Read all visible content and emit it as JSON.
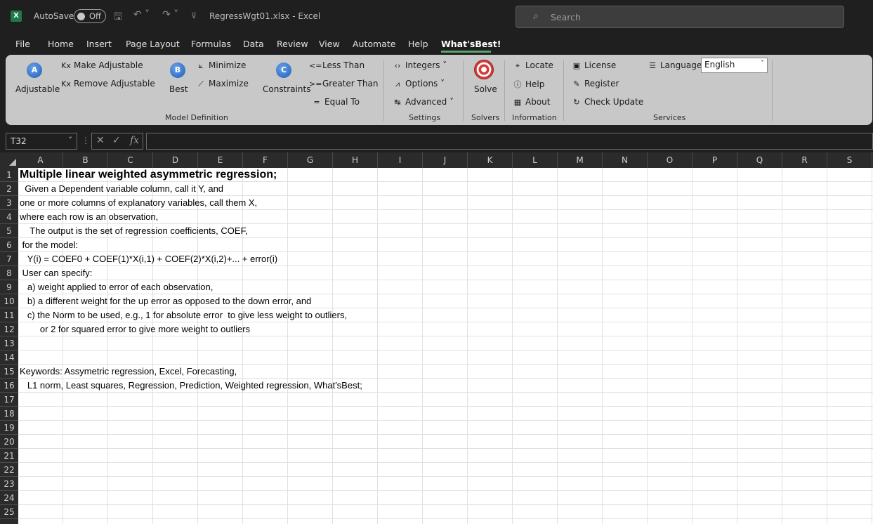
{
  "titlebar": {
    "app_icon": "X",
    "autosave_label": "AutoSave",
    "autosave_state": "Off",
    "document_title": "RegressWgt01.xlsx  -  Excel",
    "search_placeholder": "Search"
  },
  "menu": {
    "items": [
      "File",
      "Home",
      "Insert",
      "Page Layout",
      "Formulas",
      "Data",
      "Review",
      "View",
      "Automate",
      "Help",
      "What'sBest!"
    ],
    "active": "What'sBest!"
  },
  "ribbon": {
    "adjustable": "Adjustable",
    "make_adjustable": "Make Adjustable",
    "remove_adjustable": "Remove Adjustable",
    "best": "Best",
    "minimize": "Minimize",
    "maximize": "Maximize",
    "constraints": "Constraints",
    "less_than": "Less Than",
    "greater_than": "Greater Than",
    "equal_to": "Equal To",
    "group_model_definition": "Model Definition",
    "integers": "Integers",
    "options": "Options",
    "advanced": "Advanced",
    "group_settings": "Settings",
    "solve": "Solve",
    "group_solvers": "Solvers",
    "locate": "Locate",
    "help": "Help",
    "about": "About",
    "group_information": "Information",
    "license": "License",
    "register": "Register",
    "check_update": "Check Update",
    "language_label": "Language",
    "language_value": "English",
    "group_services": "Services"
  },
  "formula_bar": {
    "name_box": "T32",
    "fx": "fx",
    "content": ""
  },
  "grid": {
    "columns": [
      "A",
      "B",
      "C",
      "D",
      "E",
      "F",
      "G",
      "H",
      "I",
      "J",
      "K",
      "L",
      "M",
      "N",
      "O",
      "P",
      "Q",
      "R",
      "S"
    ],
    "rows": [
      "1",
      "2",
      "3",
      "4",
      "5",
      "6",
      "7",
      "8",
      "9",
      "10",
      "11",
      "12",
      "13",
      "14",
      "15",
      "16",
      "17",
      "18",
      "19",
      "20",
      "21",
      "22",
      "23",
      "24",
      "25"
    ],
    "cells": [
      "Multiple linear weighted asymmetric regression;",
      "  Given a Dependent variable column, call it Y, and",
      "one or more columns of explanatory variables, call them X,",
      "where each row is an observation,",
      "    The output is the set of regression coefficients, COEF,",
      " for the model:",
      "   Y(i) = COEF0 + COEF(1)*X(i,1) + COEF(2)*X(i,2)+... + error(i)",
      " User can specify:",
      "   a) weight applied to error of each observation,",
      "   b) a different weight for the up error as opposed to the down error, and",
      "   c) the Norm to be used, e.g., 1 for absolute error  to give less weight to outliers,",
      "        or 2 for squared error to give more weight to outliers",
      "",
      "",
      "Keywords: Assymetric regression, Excel, Forecasting,",
      "   L1 norm, Least squares, Regression, Prediction, Weighted regression, What'sBest;"
    ]
  }
}
